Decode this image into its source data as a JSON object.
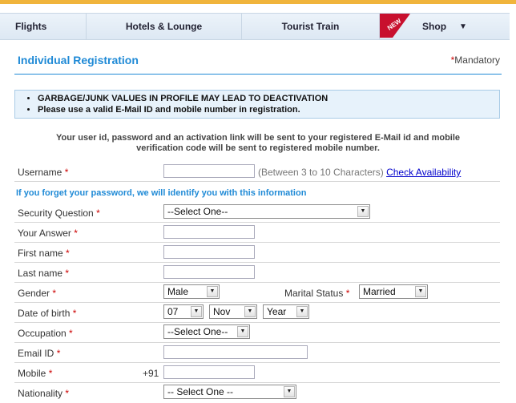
{
  "nav": {
    "items": [
      {
        "label": "Flights"
      },
      {
        "label": "Hotels & Lounge"
      },
      {
        "label": "Tourist Train"
      },
      {
        "label": "Shop",
        "badge": "NEW"
      }
    ]
  },
  "page": {
    "title": "Individual Registration",
    "mandatory_star": "*",
    "mandatory_label": "Mandatory"
  },
  "notice": {
    "lines": [
      "GARBAGE/JUNK VALUES IN PROFILE MAY LEAD TO DEACTIVATION",
      "Please use a valid E-Mail ID and mobile number in registration."
    ]
  },
  "info_text": "Your user id, password and an activation link will be sent to your registered E-Mail id and mobile verification code will be sent to registered mobile number.",
  "forget_text": "If you forget your password, we will identify you with this information",
  "form": {
    "req": "*",
    "username": {
      "label": "Username",
      "value": "",
      "hint": "(Between 3 to 10 Characters)",
      "check_link": "Check Availability"
    },
    "security_question": {
      "label": "Security Question",
      "selected": "--Select One--"
    },
    "answer": {
      "label": "Your Answer",
      "value": ""
    },
    "first_name": {
      "label": "First name",
      "value": ""
    },
    "last_name": {
      "label": "Last name",
      "value": ""
    },
    "gender": {
      "label": "Gender",
      "selected": "Male"
    },
    "marital": {
      "label": "Marital Status",
      "selected": "Married"
    },
    "dob": {
      "label": "Date of birth",
      "day": "07",
      "month": "Nov",
      "year": "Year"
    },
    "occupation": {
      "label": "Occupation",
      "selected": "--Select One--"
    },
    "email": {
      "label": "Email ID",
      "value": ""
    },
    "mobile": {
      "label": "Mobile",
      "prefix": "+91",
      "value": ""
    },
    "nationality": {
      "label": "Nationality",
      "selected": "-- Select One --"
    }
  },
  "colors": {
    "accent": "#1f8ad6",
    "topbar": "#f0b43c",
    "required": "#cc0000",
    "badge": "#c8102e"
  }
}
